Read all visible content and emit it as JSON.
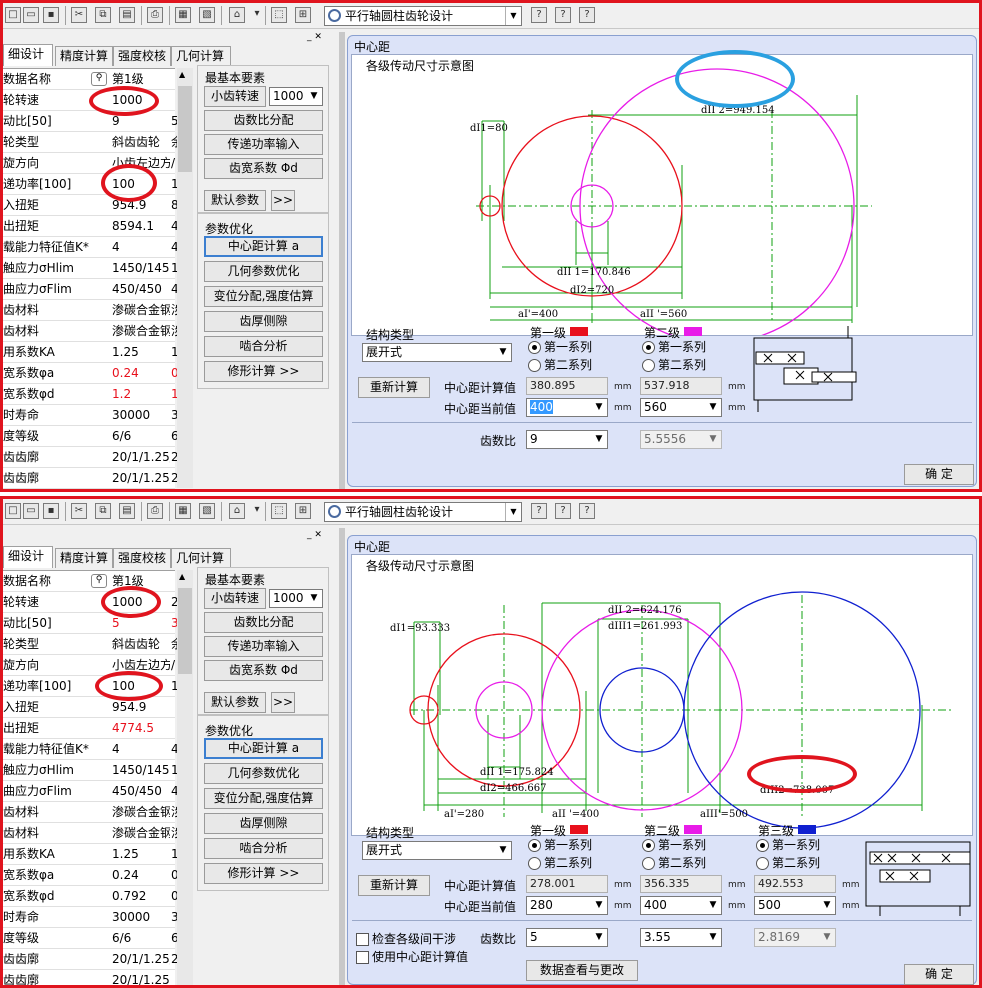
{
  "toolbar": {
    "module_select": "平行轴圆柱齿轮设计"
  },
  "tabs": [
    "细设计",
    "精度计算",
    "强度校核",
    "几何计算"
  ],
  "table_header": {
    "name": "数据名称",
    "col1": "第1级"
  },
  "side": {
    "group1": "最基本要素",
    "pinion_speed_label": "小齿转速",
    "pinion_speed_value": "1000",
    "btn_ratio": "齿数比分配",
    "btn_power": "传递功率输入",
    "btn_face": "齿宽系数 Φd",
    "btn_default": "默认参数",
    "btn_more": ">>",
    "group2": "参数优化",
    "btn_center": "中心距计算 a",
    "btn_geom": "几何参数优化",
    "btn_shift": "变位分配,强度估算",
    "btn_thick": "齿厚侧隙",
    "btn_mesh": "啮合分析",
    "btn_modify": "修形计算  >>"
  },
  "dialog": {
    "title": "中心距",
    "group_label": "各级传动尺寸示意图",
    "structure_label": "结构类型",
    "structure_value": "展开式",
    "recalc": "重新计算",
    "calc_label": "中心距计算值",
    "current_label": "中心距当前值",
    "ratio_label": "齿数比",
    "series1": "第一系列",
    "series2": "第二系列",
    "unit": "mm",
    "ok": "确  定",
    "check_interference": "检查各级间干涉",
    "use_calc": "使用中心距计算值",
    "data_view": "数据查看与更改",
    "colors": {
      "stage1": "#e8101c",
      "stage2": "#e81ce8",
      "stage3": "#1020d0"
    }
  },
  "panel1": {
    "rows": [
      {
        "k": "数据名称",
        "v": "第1级",
        "x": ""
      },
      {
        "k": "轮转速",
        "v": "1000",
        "x": ""
      },
      {
        "k": "动比[50]",
        "v": "9",
        "x": "5"
      },
      {
        "k": "轮类型",
        "v": "斜齿齿轮",
        "x": "余"
      },
      {
        "k": "旋方向",
        "v": "小齿左边方",
        "x": "/"
      },
      {
        "k": "递功率[100]",
        "v": "100",
        "x": "1"
      },
      {
        "k": "入扭矩",
        "v": "954.9",
        "x": "8"
      },
      {
        "k": "出扭矩",
        "v": "8594.1",
        "x": "4"
      },
      {
        "k": "载能力特征值K*",
        "v": "4",
        "x": "4"
      },
      {
        "k": "触应力σHlim",
        "v": "1450/1450",
        "x": "1"
      },
      {
        "k": "曲应力σFlim",
        "v": "450/450",
        "x": "4"
      },
      {
        "k": "齿材料",
        "v": "渗碳合金钢",
        "x": "涉"
      },
      {
        "k": "齿材料",
        "v": "渗碳合金钢",
        "x": "涉"
      },
      {
        "k": "用系数KA",
        "v": "1.25",
        "x": "1"
      },
      {
        "k": "宽系数φa",
        "v": "0.24",
        "x": "0",
        "red": true
      },
      {
        "k": "宽系数φd",
        "v": "1.2",
        "x": "1",
        "red": true
      },
      {
        "k": "时寿命",
        "v": "30000",
        "x": "3"
      },
      {
        "k": "度等级",
        "v": "6/6",
        "x": "6"
      },
      {
        "k": "齿齿廓",
        "v": "20/1/1.25/",
        "x": "2"
      },
      {
        "k": "齿齿廓",
        "v": "20/1/1.25/",
        "x": "2"
      }
    ],
    "stage1_label": "第一级",
    "stage2_label": "第二级",
    "calc": [
      "380.895",
      "537.918"
    ],
    "current": [
      "400",
      "560"
    ],
    "ratio": [
      "9",
      "5.5556"
    ],
    "diagram": {
      "dI1": "dⅠ1=80",
      "dII2": "dII 2=949.154",
      "dII1": "dII 1=170.846",
      "dI2": "dⅠ2=720",
      "aI": "aⅠ'=400",
      "aII": "aII '=560"
    }
  },
  "panel2": {
    "rows": [
      {
        "k": "数据名称",
        "v": "第1级",
        "x": ""
      },
      {
        "k": "轮转速",
        "v": "1000",
        "x": "2"
      },
      {
        "k": "动比[50]",
        "v": "5",
        "x": "3",
        "red": true
      },
      {
        "k": "轮类型",
        "v": "斜齿齿轮",
        "x": "余"
      },
      {
        "k": "旋方向",
        "v": "小齿左边方",
        "x": "/"
      },
      {
        "k": "递功率[100]",
        "v": "100",
        "x": "1"
      },
      {
        "k": "入扭矩",
        "v": "954.9",
        "x": ""
      },
      {
        "k": "出扭矩",
        "v": "4774.5",
        "x": "",
        "red": true
      },
      {
        "k": "载能力特征值K*",
        "v": "4",
        "x": "4"
      },
      {
        "k": "触应力σHlim",
        "v": "1450/1450",
        "x": "1"
      },
      {
        "k": "曲应力σFlim",
        "v": "450/450",
        "x": "4"
      },
      {
        "k": "齿材料",
        "v": "渗碳合金钢",
        "x": "涉"
      },
      {
        "k": "齿材料",
        "v": "渗碳合金钢",
        "x": "涉"
      },
      {
        "k": "用系数KA",
        "v": "1.25",
        "x": "1"
      },
      {
        "k": "宽系数φa",
        "v": "0.24",
        "x": "0"
      },
      {
        "k": "宽系数φd",
        "v": "0.792",
        "x": "0"
      },
      {
        "k": "时寿命",
        "v": "30000",
        "x": "3"
      },
      {
        "k": "度等级",
        "v": "6/6",
        "x": "6"
      },
      {
        "k": "齿齿廓",
        "v": "20/1/1.25/",
        "x": "2"
      },
      {
        "k": "齿齿廓",
        "v": "20/1/1.25",
        "x": ""
      }
    ],
    "stage1_label": "第一级",
    "stage2_label": "第二级",
    "stage3_label": "第三级",
    "calc": [
      "278.001",
      "356.335",
      "492.553"
    ],
    "current": [
      "280",
      "400",
      "500"
    ],
    "ratio": [
      "5",
      "3.55",
      "2.8169"
    ],
    "diagram": {
      "dI1": "dⅠ1=93.333",
      "dII2": "dII 2=624.176",
      "dIII1": "dIII1=261.993",
      "dII1": "dII 1=175.824",
      "dI2": "dⅠ2=466.667",
      "dIII2": "dIII2=738.007",
      "aI": "aⅠ'=280",
      "aII": "aII '=400",
      "aIII": "aIII'=500"
    }
  }
}
